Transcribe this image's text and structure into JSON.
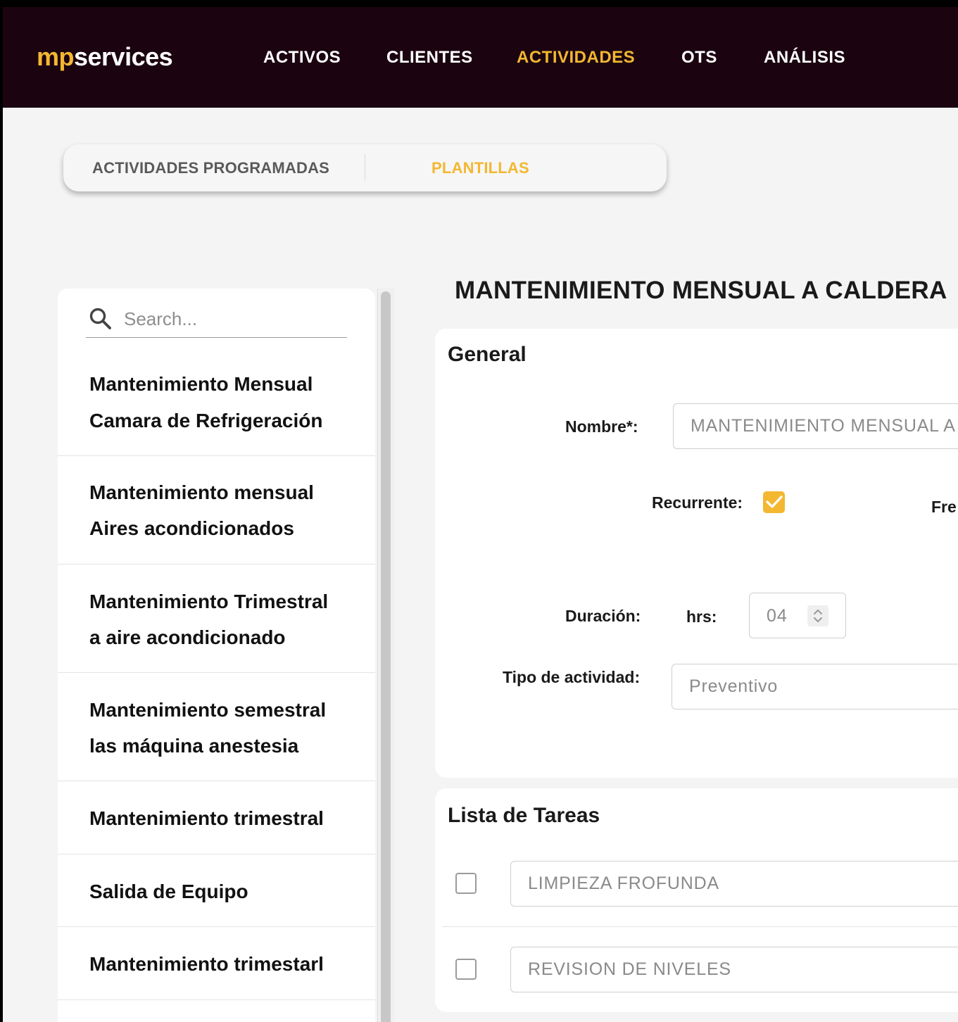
{
  "brand": {
    "prefix": "mp",
    "suffix": "services"
  },
  "nav": {
    "items": [
      {
        "label": "ACTIVOS"
      },
      {
        "label": "CLIENTES"
      },
      {
        "label": "ACTIVIDADES"
      },
      {
        "label": "OTS"
      },
      {
        "label": "ANÁLISIS"
      }
    ],
    "active": "ACTIVIDADES"
  },
  "tabs": {
    "items": [
      {
        "label": "ACTIVIDADES PROGRAMADAS"
      },
      {
        "label": "PLANTILLAS"
      }
    ],
    "active": "PLANTILLAS"
  },
  "sidebar": {
    "search_placeholder": "Search...",
    "items": [
      {
        "line1": "Mantenimiento Mensual",
        "line2": "Camara de Refrigeración"
      },
      {
        "line1": "Mantenimiento mensual",
        "line2": "Aires acondicionados"
      },
      {
        "line1": "Mantenimiento Trimestral",
        "line2": "a aire acondicionado"
      },
      {
        "line1": "Mantenimiento semestral",
        "line2": "las máquina anestesia"
      },
      {
        "line1": "Mantenimiento trimestral",
        "line2": ""
      },
      {
        "line1": "Salida de Equipo",
        "line2": ""
      },
      {
        "line1": "Mantenimiento trimestarl",
        "line2": ""
      }
    ]
  },
  "main": {
    "title": "MANTENIMIENTO MENSUAL A CALDERA",
    "general": {
      "heading": "General",
      "nombre_label": "Nombre*:",
      "nombre_value": "MANTENIMIENTO MENSUAL A CALDERA",
      "recurrente_label": "Recurrente:",
      "recurrente_checked": true,
      "frecuencia_label": "Fre",
      "duracion_label": "Duración:",
      "hrs_label": "hrs:",
      "hrs_value": "04",
      "tipo_label": "Tipo de actividad:",
      "tipo_value": "Preventivo"
    },
    "tasks": {
      "heading": "Lista de Tareas",
      "items": [
        {
          "value": "LIMPIEZA FROFUNDA",
          "checked": false
        },
        {
          "value": "REVISION DE NIVELES",
          "checked": false
        }
      ]
    }
  },
  "colors": {
    "topbar": "#1b0410",
    "accent": "#f3b731",
    "background": "#f4f4f4"
  }
}
